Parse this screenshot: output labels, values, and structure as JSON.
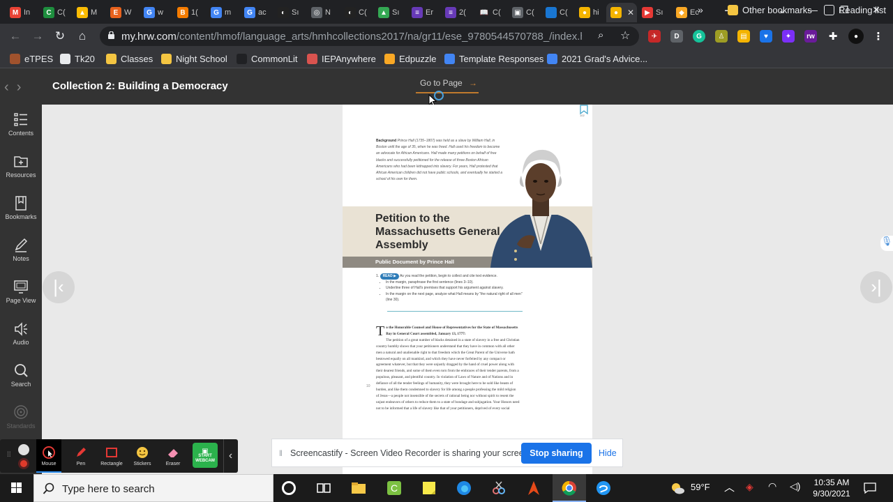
{
  "browser": {
    "tabs": [
      {
        "label": "In",
        "icon": "gmail-icon",
        "color": "#ea4335",
        "glyph": "M"
      },
      {
        "label": "C(",
        "icon": "classroom-icon",
        "color": "#1e8e3e",
        "glyph": "C"
      },
      {
        "label": "M",
        "icon": "drive-icon",
        "color": "#fbbc04",
        "glyph": "▲"
      },
      {
        "label": "W",
        "icon": "etsy-icon",
        "color": "#e8621d",
        "glyph": "E"
      },
      {
        "label": "w",
        "icon": "google-icon",
        "color": "#4285f4",
        "glyph": "G"
      },
      {
        "label": "1(",
        "icon": "blogger-icon",
        "color": "#f57c00",
        "glyph": "B"
      },
      {
        "label": "m",
        "icon": "google-icon",
        "color": "#4285f4",
        "glyph": "G"
      },
      {
        "label": "ac",
        "icon": "google-icon",
        "color": "#4285f4",
        "glyph": "G"
      },
      {
        "label": "Sı",
        "icon": "planet-icon",
        "color": "#222",
        "glyph": "◐"
      },
      {
        "label": "N",
        "icon": "chrome-icon",
        "color": "#5f6368",
        "glyph": "◎"
      },
      {
        "label": "C(",
        "icon": "planet-icon",
        "color": "#222",
        "glyph": "◐"
      },
      {
        "label": "Sı",
        "icon": "drive-icon",
        "color": "#34a853",
        "glyph": "▲"
      },
      {
        "label": "Er",
        "icon": "forms-icon",
        "color": "#673ab7",
        "glyph": "≡"
      },
      {
        "label": "2(",
        "icon": "forms-icon",
        "color": "#673ab7",
        "glyph": "≡"
      },
      {
        "label": "C(",
        "icon": "commonlit-icon",
        "color": "#202124",
        "glyph": "📖"
      },
      {
        "label": "C(",
        "icon": "slides-icon",
        "color": "#5f6368",
        "glyph": "▣"
      },
      {
        "label": "C(",
        "icon": "classroom-icon",
        "color": "#1976d2",
        "glyph": "👤"
      },
      {
        "label": "hi",
        "icon": "hmh-icon",
        "color": "#f4b400",
        "glyph": "●"
      },
      {
        "label": "",
        "icon": "hmh-icon",
        "color": "#f4b400",
        "glyph": "●",
        "active": true
      },
      {
        "label": "Sı",
        "icon": "screencastify-icon",
        "color": "#e53935",
        "glyph": "▶"
      },
      {
        "label": "Ec",
        "icon": "edpuzzle-icon",
        "color": "#f9a825",
        "glyph": "◆"
      }
    ],
    "new_tab": "+",
    "window_controls": [
      "⌄",
      "—",
      "❐",
      "✕"
    ],
    "url_domain": "my.hrw.com",
    "url_path": "/content/hmof/language_arts/hmhcollections2017/na/gr11/ese_9780544570788_/index.html?p...",
    "bookmarks": [
      {
        "label": "eTPES",
        "color": "#a0522d"
      },
      {
        "label": "Tk20",
        "color": "#e8eaed"
      },
      {
        "label": "Classes",
        "color": "#f4c542"
      },
      {
        "label": "Night School",
        "color": "#f4c542"
      },
      {
        "label": "CommonLit",
        "color": "#202124"
      },
      {
        "label": "IEPAnywhere",
        "color": "#d9534f"
      },
      {
        "label": "Edpuzzle",
        "color": "#f9a825"
      },
      {
        "label": "Template Responses",
        "color": "#4285f4"
      },
      {
        "label": "2021 Grad's Advice...",
        "color": "#4285f4"
      }
    ],
    "bookmarks_overflow": "»",
    "other_bookmarks": "Other bookmarks",
    "reading_list": "Reading list"
  },
  "reader": {
    "collection_title": "Collection 2: Building a Democracy",
    "go_to_page": "Go to Page",
    "go_arrow": "→",
    "sidebar": [
      {
        "label": "Contents",
        "icon": "contents-icon"
      },
      {
        "label": "Resources",
        "icon": "resources-icon"
      },
      {
        "label": "Bookmarks",
        "icon": "bookmarks-icon"
      },
      {
        "label": "Notes",
        "icon": "notes-icon"
      },
      {
        "label": "Page View",
        "icon": "page-view-icon"
      },
      {
        "label": "Audio",
        "icon": "audio-icon"
      },
      {
        "label": "Search",
        "icon": "search-icon"
      },
      {
        "label": "Standards",
        "icon": "standards-icon",
        "disabled": true
      }
    ],
    "prev_page": "|‹",
    "next_page": "›|"
  },
  "page": {
    "page_number": "102",
    "background_label": "Background",
    "background_text": "Prince Hall (1735–1807) was held as a slave by William Hall, in Boston until the age of 35, when he was freed. Hall used his freedom to become an advocate for African Americans. Hall made many petitions on behalf of free blacks and successfully petitioned for the release of three Boston African Americans who had been kidnapped into slavery. For years, Hall protested that African American children did not have public schools, and eventually he started a school of his own for them.",
    "title": "Petition to the Massachusetts General Assembly",
    "subtitle": "Public Document by Prince Hall",
    "read_number": "1.",
    "read_badge": "READ ▶",
    "read_intro": "As you read the petition, begin to collect and cite text evidence.",
    "read_bullets": [
      "In the margin, paraphrase the first sentence (lines 3–10).",
      "Underline three of Hall's premises that support his argument against slavery.",
      "In the margin on the next page, analyze what Hall means by \"the natural right of all men\" (line 30)."
    ],
    "dropcap": "T",
    "text_head": "o the Honorable Counsel and House of Representatives for the State of Massachusetts Bay in General Court assembled, January 13, 1777:",
    "text_body": "The petition of a great number of blacks detained in a state of slavery in a free and Christian country humbly shows that your petitioners understand that they have in common with all other men a natural and unalienable right to that freedom which the Great Parent of the Universe hath bestowed equally on all mankind, and which they have never forfeited by any compact or agreement whatever, but that they were unjustly dragged by the hand of cruel power along with their dearest friends, and some of them even torn from the embraces of their tender parents, from a populous, pleasant, and plentiful country. In violation of Laws of Nature and of Nations and in defiance of all the tender feelings of humanity, they were brought here to be sold like beasts of burden, and like them condemned to slavery for life among a people professing the mild religion of Jesus—a people not insensible of the secrets of rational being nor without spirit to resent the unjust endeavors of others to reduce them to a state of bondage and subjugation. Your Honors need not to be informed that a life of slavery like that of your petitioners, deprived of every social",
    "line_number": "10"
  },
  "screencastify": {
    "tools": [
      {
        "label": "Mouse",
        "icon": "mouse-icon",
        "active": true
      },
      {
        "label": "Pen",
        "icon": "pen-icon"
      },
      {
        "label": "Rectangle",
        "icon": "rectangle-icon"
      },
      {
        "label": "Stickers",
        "icon": "stickers-icon"
      },
      {
        "label": "Eraser",
        "icon": "eraser-icon"
      },
      {
        "label": "START WEBCAM",
        "icon": "webcam-icon"
      }
    ],
    "collapse": "‹",
    "share_message": "Screencastify - Screen Video Recorder is sharing your screen.",
    "stop_sharing": "Stop sharing",
    "hide": "Hide"
  },
  "taskbar": {
    "search_placeholder": "Type here to search",
    "temperature": "59°F",
    "time": "10:35 AM",
    "date": "9/30/2021"
  }
}
